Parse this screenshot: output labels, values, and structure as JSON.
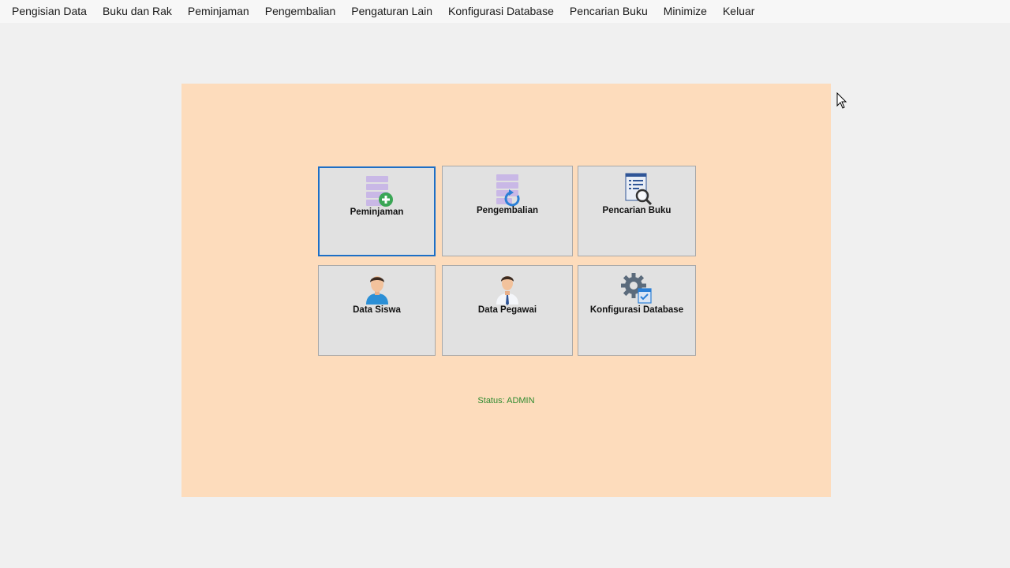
{
  "menu": {
    "items": [
      {
        "label": "Pengisian Data"
      },
      {
        "label": "Buku dan Rak"
      },
      {
        "label": "Peminjaman"
      },
      {
        "label": "Pengembalian"
      },
      {
        "label": "Pengaturan Lain"
      },
      {
        "label": "Konfigurasi Database"
      },
      {
        "label": "Pencarian Buku"
      },
      {
        "label": "Minimize"
      },
      {
        "label": "Keluar"
      }
    ]
  },
  "tiles": [
    {
      "label": "Peminjaman",
      "icon": "database-add-icon",
      "selected": true
    },
    {
      "label": "Pengembalian",
      "icon": "database-return-icon",
      "selected": false
    },
    {
      "label": "Pencarian Buku",
      "icon": "document-search-icon",
      "selected": false
    },
    {
      "label": "Data Siswa",
      "icon": "student-icon",
      "selected": false
    },
    {
      "label": "Data Pegawai",
      "icon": "employee-icon",
      "selected": false
    },
    {
      "label": "Konfigurasi Database",
      "icon": "gear-checklist-icon",
      "selected": false
    }
  ],
  "status": {
    "text": "Status: ADMIN"
  },
  "colors": {
    "panel": "#fddcbc",
    "tile": "#e1e1e1",
    "selected_border": "#1d6fc6",
    "status_text": "#2f8a2f"
  }
}
